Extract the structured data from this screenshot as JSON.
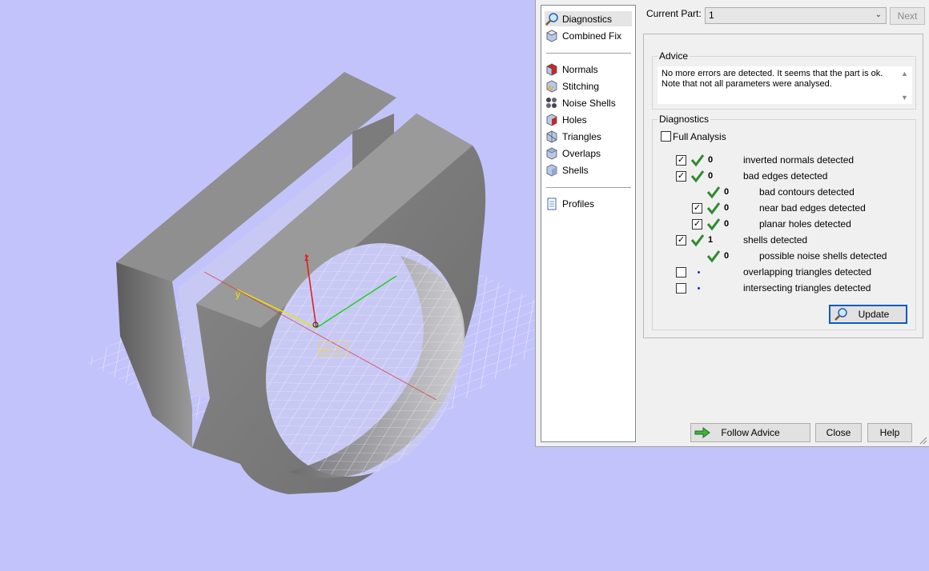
{
  "viewport": {
    "axis_x": "",
    "axis_y": "y",
    "axis_z": "z",
    "coordinate_label": "WCS"
  },
  "nav": {
    "items": [
      {
        "label": "Diagnostics",
        "icon": "magnifier-icon",
        "selected": true
      },
      {
        "label": "Combined Fix",
        "icon": "cube-icon"
      },
      {
        "label": "Normals",
        "icon": "normals-cube-icon"
      },
      {
        "label": "Stitching",
        "icon": "stitching-icon"
      },
      {
        "label": "Noise Shells",
        "icon": "noise-shells-icon"
      },
      {
        "label": "Holes",
        "icon": "holes-cube-icon"
      },
      {
        "label": "Triangles",
        "icon": "triangles-icon"
      },
      {
        "label": "Overlaps",
        "icon": "overlaps-icon"
      },
      {
        "label": "Shells",
        "icon": "shells-icon"
      },
      {
        "label": "Profiles",
        "icon": "document-icon"
      }
    ]
  },
  "toolbar": {
    "current_part_label": "Current Part:",
    "current_part_value": "1",
    "next_label": "Next"
  },
  "advice": {
    "title": "Advice",
    "text_line1": "No more errors are detected. It seems that the part is ok.",
    "text_line2": "Note that not all parameters were analysed."
  },
  "diagnostics": {
    "title": "Diagnostics",
    "full_analysis_label": "Full Analysis",
    "full_analysis_checked": false,
    "rows": [
      {
        "label": "inverted normals detected",
        "count": "0",
        "checked": true,
        "status": "ok"
      },
      {
        "label": "bad edges detected",
        "count": "0",
        "checked": true,
        "status": "ok"
      },
      {
        "label": "bad contours detected",
        "count": "0",
        "checked": null,
        "status": "ok"
      },
      {
        "label": "near bad edges detected",
        "count": "0",
        "checked": true,
        "status": "ok"
      },
      {
        "label": "planar holes detected",
        "count": "0",
        "checked": true,
        "status": "ok"
      },
      {
        "label": "shells detected",
        "count": "1",
        "checked": true,
        "status": "ok"
      },
      {
        "label": "possible noise shells detected",
        "count": "0",
        "checked": null,
        "status": "ok"
      },
      {
        "label": "overlapping triangles detected",
        "count": "",
        "checked": false,
        "status": "not-run"
      },
      {
        "label": "intersecting triangles detected",
        "count": "",
        "checked": false,
        "status": "not-run"
      }
    ],
    "update_label": "Update"
  },
  "footer": {
    "follow_advice_label": "Follow Advice",
    "close_label": "Close",
    "help_label": "Help"
  },
  "colors": {
    "background": "#c3c3fb",
    "tick_green": "#2f8a2f",
    "axis_x": "#e01818",
    "axis_y": "#e8e800",
    "axis_z": "#20d020"
  }
}
